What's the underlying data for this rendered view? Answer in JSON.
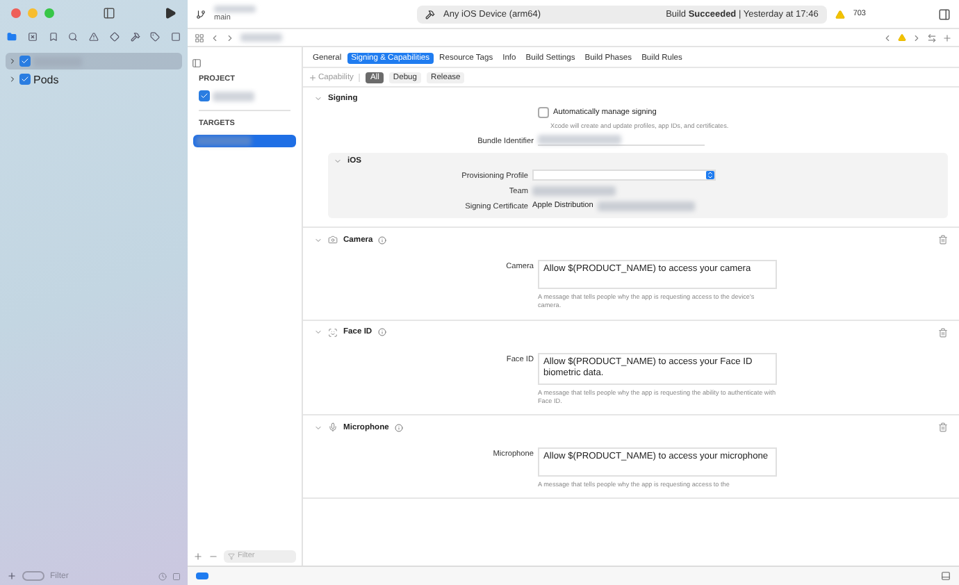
{
  "toolbar": {
    "branch": "main",
    "destination": "Any iOS Device (arm64)",
    "status": "Build **Succeeded** | Yesterday at 17:46",
    "warnings": "703"
  },
  "navigator": {
    "items": [
      {
        "kind": "redacted",
        "selected": true,
        "expanded": false
      },
      {
        "kind": "text",
        "label": "Pods",
        "selected": false,
        "expanded": false
      }
    ],
    "filter_placeholder": "Filter"
  },
  "tabs": [
    {
      "label": "General",
      "selected": false
    },
    {
      "label": "Signing & Capabilities",
      "selected": true
    },
    {
      "label": "Resource Tags",
      "selected": false
    },
    {
      "label": "Info",
      "selected": false
    },
    {
      "label": "Build Settings",
      "selected": false
    },
    {
      "label": "Build Phases",
      "selected": false
    },
    {
      "label": "Build Rules",
      "selected": false
    }
  ],
  "editor_sidebar": {
    "project_heading": "PROJECT",
    "targets_heading": "TARGETS",
    "filter_placeholder": "Filter"
  },
  "capability_bar": {
    "add_label": "Capability",
    "filters": [
      {
        "label": "All",
        "selected": true
      },
      {
        "label": "Debug",
        "selected": false
      },
      {
        "label": "Release",
        "selected": false
      }
    ]
  },
  "signing": {
    "title": "Signing",
    "auto_manage": {
      "label": "Automatically manage signing",
      "checked": false,
      "hint": "Xcode will create and update profiles, app IDs, and certificates."
    },
    "bundle_label": "Bundle Identifier",
    "platform": "iOS",
    "rows": [
      {
        "kind": "popup",
        "label": "Provisioning Profile"
      },
      {
        "kind": "redacted",
        "label": "Team"
      },
      {
        "kind": "text",
        "label": "Signing Certificate",
        "value": "Apple Distribution"
      }
    ]
  },
  "capabilities": [
    {
      "kind": "camera",
      "title": "Camera",
      "field_label": "Camera",
      "value": "Allow $(PRODUCT_NAME) to access your camera",
      "hint": "A message that tells people why the app is requesting access to the device's camera."
    },
    {
      "kind": "faceid",
      "title": "Face ID",
      "field_label": "Face ID",
      "value": "Allow $(PRODUCT_NAME) to access your Face ID biometric data.",
      "hint": "A message that tells people why the app is requesting the ability to authenticate with Face ID."
    },
    {
      "kind": "mic",
      "title": "Microphone",
      "field_label": "Microphone",
      "value": "Allow $(PRODUCT_NAME) to access your microphone",
      "hint": "A message that tells people why the app is requesting access to the"
    }
  ]
}
